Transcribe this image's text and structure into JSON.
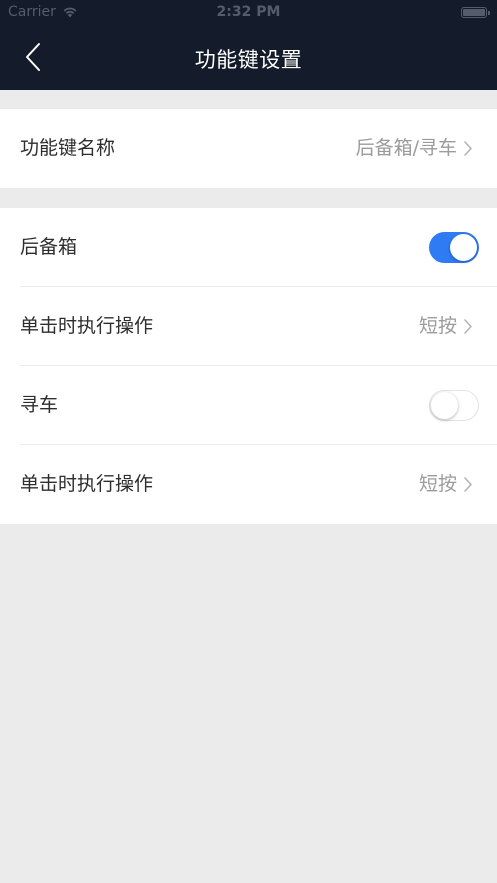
{
  "status_bar": {
    "carrier": "Carrier",
    "time": "2:32 PM",
    "wifi_icon": "wifi-icon",
    "battery_icon": "battery-icon"
  },
  "nav": {
    "title": "功能键设置",
    "back_icon": "chevron-left-icon"
  },
  "settings": {
    "key_name": {
      "label": "功能键名称",
      "value": "后备箱/寻车"
    },
    "trunk": {
      "label": "后备箱",
      "enabled": true
    },
    "trunk_action": {
      "label": "单击时执行操作",
      "value": "短按"
    },
    "find_car": {
      "label": "寻车",
      "enabled": false
    },
    "find_car_action": {
      "label": "单击时执行操作",
      "value": "短按"
    }
  },
  "colors": {
    "nav_background": "#141b2b",
    "page_background": "#ebebeb",
    "toggle_on": "#2f7bf3",
    "secondary_text": "#9b9b9b"
  }
}
